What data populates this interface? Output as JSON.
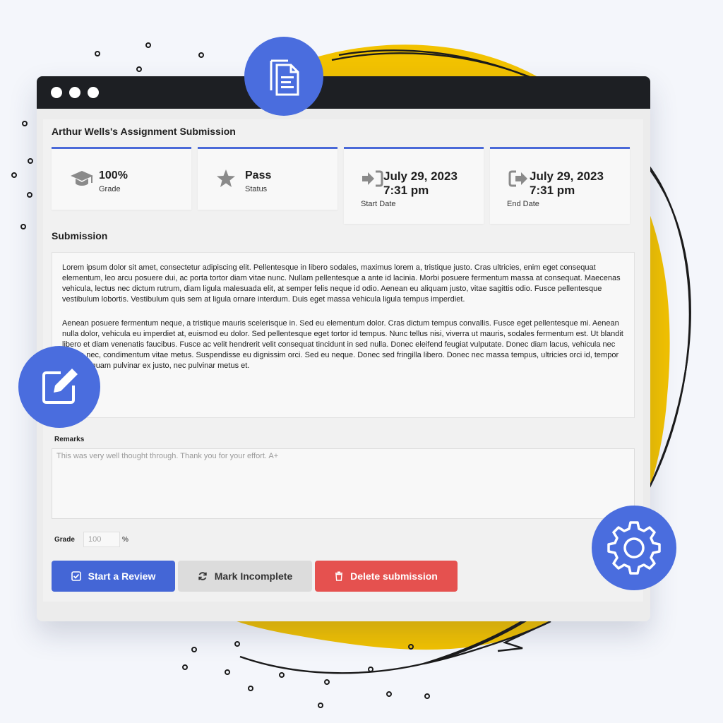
{
  "heading": "Arthur Wells's Assignment Submission",
  "stats": [
    {
      "icon": "graduation-cap-icon",
      "value": "100%",
      "label": "Grade"
    },
    {
      "icon": "star-icon",
      "value": "Pass",
      "label": "Status"
    },
    {
      "icon": "sign-in-icon",
      "value": "July 29, 2023",
      "value2": "7:31 pm",
      "label": "Start Date"
    },
    {
      "icon": "sign-out-icon",
      "value": "July 29, 2023",
      "value2": "7:31 pm",
      "label": "End Date"
    }
  ],
  "submission": {
    "title": "Submission",
    "paragraphs": [
      "Lorem ipsum dolor sit amet, consectetur adipiscing elit. Pellentesque in libero sodales, maximus lorem a, tristique justo. Cras ultricies, enim eget consequat elementum, leo arcu posuere dui, ac porta tortor diam vitae nunc. Nullam pellentesque a ante id lacinia. Morbi posuere fermentum massa at consequat. Maecenas vehicula, lectus nec dictum rutrum, diam ligula malesuada elit, at semper felis neque id odio. Aenean eu aliquam justo, vitae sagittis odio. Fusce pellentesque vestibulum lobortis. Vestibulum quis sem at ligula ornare interdum. Duis eget massa vehicula ligula tempus imperdiet.",
      "Aenean posuere fermentum neque, a tristique mauris scelerisque in. Sed eu elementum dolor. Cras dictum tempus convallis. Fusce eget pellentesque mi. Aenean nulla dolor, vehicula eu imperdiet at, euismod eu dolor. Sed pellentesque eget tortor id tempus. Nunc tellus nisi, viverra ut mauris, sodales fermentum est. Ut blandit libero et diam venenatis faucibus. Fusce ac velit hendrerit velit consequat tincidunt in sed nulla. Donec eleifend feugiat vulputate. Donec diam lacus, vehicula nec lacinia nec, condimentum vitae metus. Suspendisse eu dignissim orci. Sed eu neque. Donec sed fringilla libero. Donec nec massa tempus, ultricies orci id, tempor enim. Aliquam pulvinar ex justo, nec pulvinar metus et."
    ]
  },
  "remarks": {
    "label": "Remarks",
    "value": "This was very well thought through. Thank you for your effort. A+"
  },
  "grade": {
    "label": "Grade",
    "placeholder": "100",
    "suffix": "%"
  },
  "buttons": {
    "review": "Start a Review",
    "incomplete": "Mark Incomplete",
    "delete": "Delete submission"
  },
  "colors": {
    "accent": "#4a6dde",
    "danger": "#e5514f",
    "blob": "#f2c200",
    "titlebar": "#1d1f23"
  },
  "badges": [
    "document-icon",
    "edit-icon",
    "gear-icon"
  ]
}
